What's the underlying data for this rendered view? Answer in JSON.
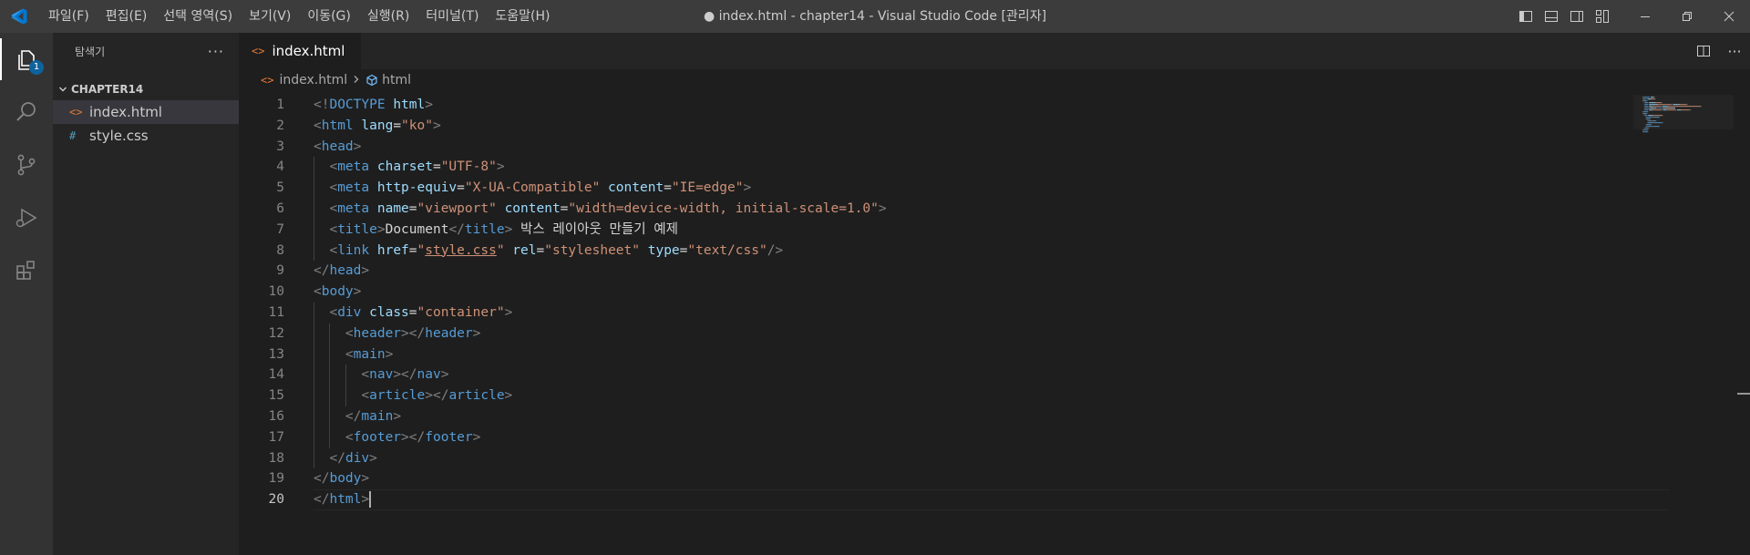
{
  "titlebar": {
    "menu": [
      "파일(F)",
      "편집(E)",
      "선택 영역(S)",
      "보기(V)",
      "이동(G)",
      "실행(R)",
      "터미널(T)",
      "도움말(H)"
    ],
    "window_title": "● index.html - chapter14 - Visual Studio Code [관리자]"
  },
  "activitybar": {
    "items": [
      "explorer-icon",
      "search-icon",
      "source-control-icon",
      "run-debug-icon",
      "extensions-icon"
    ],
    "explorer_badge": "1"
  },
  "sidebar": {
    "title": "탐색기",
    "folder": "CHAPTER14",
    "files": [
      {
        "icon": "<>",
        "name": "index.html"
      },
      {
        "icon": "#",
        "name": "style.css"
      }
    ]
  },
  "editor": {
    "tab": {
      "icon": "<>",
      "label": "index.html"
    },
    "breadcrumb": {
      "file": "index.html",
      "symbol": "html"
    },
    "current_line": 20,
    "lines": [
      [
        [
          "p",
          "<!"
        ],
        [
          "t",
          "DOCTYPE"
        ],
        [
          "x",
          " "
        ],
        [
          "a",
          "html"
        ],
        [
          "p",
          ">"
        ]
      ],
      [
        [
          "p",
          "<"
        ],
        [
          "t",
          "html"
        ],
        [
          "x",
          " "
        ],
        [
          "a",
          "lang"
        ],
        [
          "x",
          "="
        ],
        [
          "v",
          "\"ko\""
        ],
        [
          "p",
          ">"
        ]
      ],
      [
        [
          "p",
          "<"
        ],
        [
          "t",
          "head"
        ],
        [
          "p",
          ">"
        ]
      ],
      [
        [
          "x",
          "  "
        ],
        [
          "p",
          "<"
        ],
        [
          "t",
          "meta"
        ],
        [
          "x",
          " "
        ],
        [
          "a",
          "charset"
        ],
        [
          "x",
          "="
        ],
        [
          "v",
          "\"UTF-8\""
        ],
        [
          "p",
          ">"
        ]
      ],
      [
        [
          "x",
          "  "
        ],
        [
          "p",
          "<"
        ],
        [
          "t",
          "meta"
        ],
        [
          "x",
          " "
        ],
        [
          "a",
          "http-equiv"
        ],
        [
          "x",
          "="
        ],
        [
          "v",
          "\"X-UA-Compatible\""
        ],
        [
          "x",
          " "
        ],
        [
          "a",
          "content"
        ],
        [
          "x",
          "="
        ],
        [
          "v",
          "\"IE=edge\""
        ],
        [
          "p",
          ">"
        ]
      ],
      [
        [
          "x",
          "  "
        ],
        [
          "p",
          "<"
        ],
        [
          "t",
          "meta"
        ],
        [
          "x",
          " "
        ],
        [
          "a",
          "name"
        ],
        [
          "x",
          "="
        ],
        [
          "v",
          "\"viewport\""
        ],
        [
          "x",
          " "
        ],
        [
          "a",
          "content"
        ],
        [
          "x",
          "="
        ],
        [
          "v",
          "\"width=device-width, initial-scale=1.0\""
        ],
        [
          "p",
          ">"
        ]
      ],
      [
        [
          "x",
          "  "
        ],
        [
          "p",
          "<"
        ],
        [
          "t",
          "title"
        ],
        [
          "p",
          ">"
        ],
        [
          "x",
          "Document"
        ],
        [
          "p",
          "</"
        ],
        [
          "t",
          "title"
        ],
        [
          "p",
          ">"
        ],
        [
          "x",
          " 박스 레이아웃 만들기 예제"
        ]
      ],
      [
        [
          "x",
          "  "
        ],
        [
          "p",
          "<"
        ],
        [
          "t",
          "link"
        ],
        [
          "x",
          " "
        ],
        [
          "a",
          "href"
        ],
        [
          "x",
          "="
        ],
        [
          "v",
          "\""
        ],
        [
          "u",
          "style.css"
        ],
        [
          "v",
          "\""
        ],
        [
          "x",
          " "
        ],
        [
          "a",
          "rel"
        ],
        [
          "x",
          "="
        ],
        [
          "v",
          "\"stylesheet\""
        ],
        [
          "x",
          " "
        ],
        [
          "a",
          "type"
        ],
        [
          "x",
          "="
        ],
        [
          "v",
          "\"text/css\""
        ],
        [
          "p",
          "/>"
        ]
      ],
      [
        [
          "p",
          "</"
        ],
        [
          "t",
          "head"
        ],
        [
          "p",
          ">"
        ]
      ],
      [
        [
          "p",
          "<"
        ],
        [
          "t",
          "body"
        ],
        [
          "p",
          ">"
        ]
      ],
      [
        [
          "x",
          "  "
        ],
        [
          "p",
          "<"
        ],
        [
          "t",
          "div"
        ],
        [
          "x",
          " "
        ],
        [
          "a",
          "class"
        ],
        [
          "x",
          "="
        ],
        [
          "v",
          "\"container\""
        ],
        [
          "p",
          ">"
        ]
      ],
      [
        [
          "x",
          "    "
        ],
        [
          "p",
          "<"
        ],
        [
          "t",
          "header"
        ],
        [
          "p",
          "></"
        ],
        [
          "t",
          "header"
        ],
        [
          "p",
          ">"
        ]
      ],
      [
        [
          "x",
          "    "
        ],
        [
          "p",
          "<"
        ],
        [
          "t",
          "main"
        ],
        [
          "p",
          ">"
        ]
      ],
      [
        [
          "x",
          "      "
        ],
        [
          "p",
          "<"
        ],
        [
          "t",
          "nav"
        ],
        [
          "p",
          "></"
        ],
        [
          "t",
          "nav"
        ],
        [
          "p",
          ">"
        ]
      ],
      [
        [
          "x",
          "      "
        ],
        [
          "p",
          "<"
        ],
        [
          "t",
          "article"
        ],
        [
          "p",
          "></"
        ],
        [
          "t",
          "article"
        ],
        [
          "p",
          ">"
        ]
      ],
      [
        [
          "x",
          "    "
        ],
        [
          "p",
          "</"
        ],
        [
          "t",
          "main"
        ],
        [
          "p",
          ">"
        ]
      ],
      [
        [
          "x",
          "    "
        ],
        [
          "p",
          "<"
        ],
        [
          "t",
          "footer"
        ],
        [
          "p",
          "></"
        ],
        [
          "t",
          "footer"
        ],
        [
          "p",
          ">"
        ]
      ],
      [
        [
          "x",
          "  "
        ],
        [
          "p",
          "</"
        ],
        [
          "t",
          "div"
        ],
        [
          "p",
          ">"
        ]
      ],
      [
        [
          "p",
          "</"
        ],
        [
          "t",
          "body"
        ],
        [
          "p",
          ">"
        ]
      ],
      [
        [
          "p",
          "</"
        ],
        [
          "t",
          "html"
        ],
        [
          "p",
          ">"
        ]
      ]
    ]
  },
  "colors": {
    "titlebar_bg": "#3c3c3c",
    "activitybar_bg": "#333333",
    "sidebar_bg": "#252526",
    "editor_bg": "#1e1e1e",
    "tag": "#569cd6",
    "attribute": "#9cdcfe",
    "string": "#ce9178",
    "punctuation": "#808080",
    "badge": "#0e639c"
  }
}
